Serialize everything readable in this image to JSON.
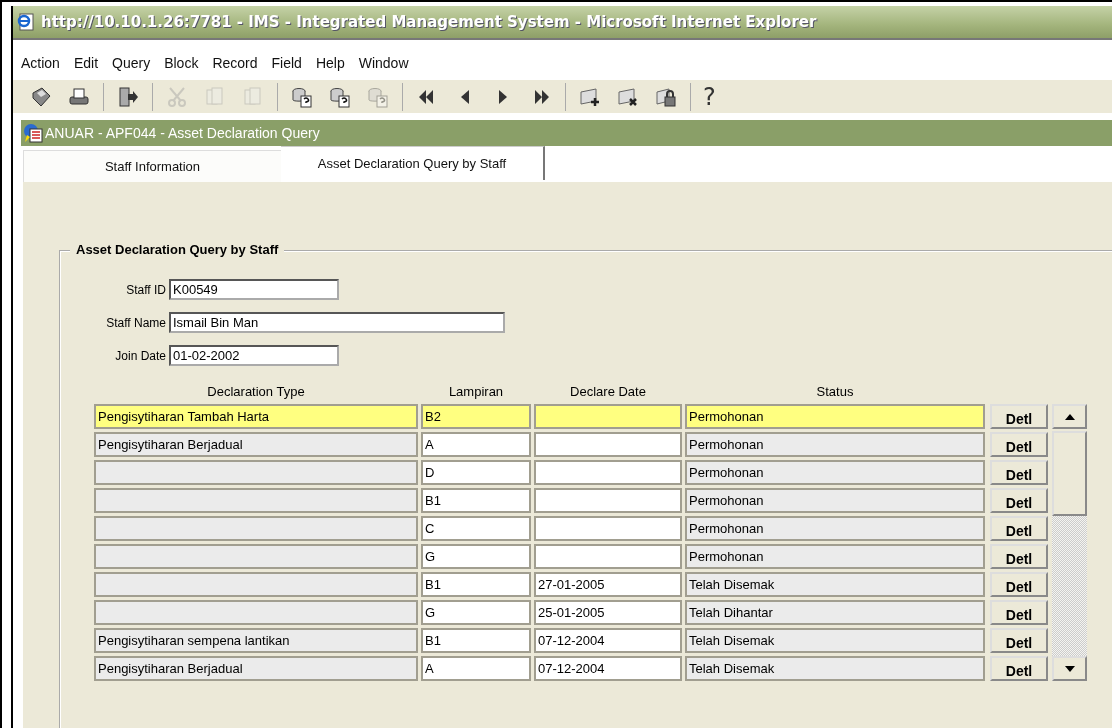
{
  "window": {
    "title": "http://10.10.1.26:7781  - IMS - Integrated Management System - Microsoft Internet Explorer"
  },
  "menu": [
    "Action",
    "Edit",
    "Query",
    "Block",
    "Record",
    "Field",
    "Help",
    "Window"
  ],
  "toolbar": [
    [
      {
        "kind": "save",
        "disabled": false
      },
      {
        "kind": "print",
        "disabled": false
      }
    ],
    [
      {
        "kind": "exit",
        "disabled": false
      }
    ],
    [
      {
        "kind": "cut",
        "disabled": true
      },
      {
        "kind": "copy",
        "disabled": true
      },
      {
        "kind": "paste",
        "disabled": true
      }
    ],
    [
      {
        "kind": "enter-query",
        "disabled": false
      },
      {
        "kind": "execute-query",
        "disabled": false
      },
      {
        "kind": "cancel-query",
        "disabled": true
      }
    ],
    [
      {
        "kind": "first",
        "disabled": false
      },
      {
        "kind": "previous",
        "disabled": false
      },
      {
        "kind": "next",
        "disabled": false
      },
      {
        "kind": "last",
        "disabled": false
      }
    ],
    [
      {
        "kind": "insert",
        "disabled": false
      },
      {
        "kind": "delete",
        "disabled": false
      },
      {
        "kind": "lock",
        "disabled": false
      }
    ]
  ],
  "help_button": "?",
  "form_window": {
    "title": "ANUAR - APF044 - Asset Declaration Query"
  },
  "tabs": [
    {
      "label": "Staff Information",
      "selected": false
    },
    {
      "label": "Asset Declaration Query by Staff",
      "selected": true
    }
  ],
  "section": {
    "title": "Asset Declaration Query by Staff"
  },
  "fields": [
    {
      "label": "Staff ID",
      "value": "K00549"
    },
    {
      "label": "Staff Name",
      "value": "Ismail Bin Man"
    },
    {
      "label": "Join Date",
      "value": "01-02-2002"
    }
  ],
  "table": {
    "columns": [
      "Declaration Type",
      "Lampiran",
      "Declare Date",
      "Status"
    ],
    "rows": [
      {
        "type": "Pengisytiharan Tambah Harta",
        "lampiran": "B2",
        "date": "",
        "status": "Permohonan",
        "button": "Detl",
        "selected": true
      },
      {
        "type": "Pengisytiharan Berjadual",
        "lampiran": "A",
        "date": "",
        "status": "Permohonan",
        "button": "Detl",
        "selected": false
      },
      {
        "type": "",
        "lampiran": "D",
        "date": "",
        "status": "Permohonan",
        "button": "Detl",
        "selected": false
      },
      {
        "type": "",
        "lampiran": "B1",
        "date": "",
        "status": "Permohonan",
        "button": "Detl",
        "selected": false
      },
      {
        "type": "",
        "lampiran": "C",
        "date": "",
        "status": "Permohonan",
        "button": "Detl",
        "selected": false
      },
      {
        "type": "",
        "lampiran": "G",
        "date": "",
        "status": "Permohonan",
        "button": "Detl",
        "selected": false
      },
      {
        "type": "",
        "lampiran": "B1",
        "date": "27-01-2005",
        "status": "Telah Disemak",
        "button": "Detl",
        "selected": false
      },
      {
        "type": "",
        "lampiran": "G",
        "date": "25-01-2005",
        "status": "Telah Dihantar",
        "button": "Detl",
        "selected": false
      },
      {
        "type": "Pengisytiharan sempena lantikan",
        "lampiran": "B1",
        "date": "07-12-2004",
        "status": "Telah Disemak",
        "button": "Detl",
        "selected": false
      },
      {
        "type": "Pengisytiharan Berjadual",
        "lampiran": "A",
        "date": "07-12-2004",
        "status": "Telah Disemak",
        "button": "Detl",
        "selected": false
      }
    ]
  }
}
